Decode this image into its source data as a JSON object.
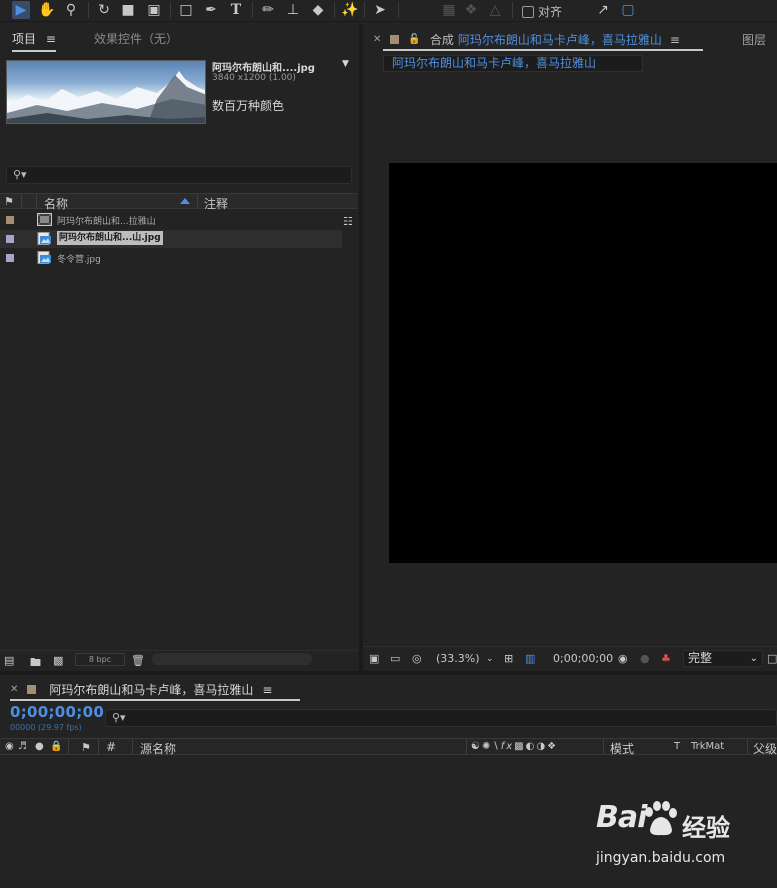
{
  "toolbar": {
    "tools": [
      "selection-tool",
      "hand-tool",
      "zoom-tool",
      "rotate-tool",
      "camera-tool",
      "pan-behind-tool",
      "rectangle-tool",
      "pen-tool",
      "type-tool",
      "brush-tool",
      "clone-stamp-tool",
      "eraser-tool",
      "roto-brush-tool",
      "puppet-pin-tool"
    ],
    "snap_label": "对齐"
  },
  "project_panel": {
    "tab_project": "项目",
    "tab_project_menu": "≡",
    "tab_effects": "效果控件（无）",
    "preview": {
      "name": "阿玛尔布朗山和....jpg",
      "dimensions": "3840 x1200 (1.00)",
      "color_info": "数百万种颜色"
    },
    "columns": {
      "name": "名称",
      "comment": "注释"
    },
    "items": [
      {
        "label": "阿玛尔布朗山和...拉雅山",
        "type": "composition",
        "label_color": "#a38f70",
        "selected": false
      },
      {
        "label": "阿玛尔布朗山和...山.jpg",
        "type": "footage",
        "label_color": "#a8a4c8",
        "selected": true
      },
      {
        "label": "冬令营.jpg",
        "type": "footage",
        "label_color": "#a8a4c8",
        "selected": false
      }
    ],
    "bpc": "8 bpc"
  },
  "comp_panel": {
    "tab_prefix": "合成",
    "comp_name": "阿玛尔布朗山和马卡卢峰，喜马拉雅山",
    "tab_menu": "≡",
    "layers_tab": "图层",
    "breadcrumb": "阿玛尔布朗山和马卡卢峰，喜马拉雅山",
    "zoom": "(33.3%)",
    "timecode": "0;00;00;00",
    "quality": "完整"
  },
  "timeline": {
    "comp_name": "阿玛尔布朗山和马卡卢峰，喜马拉雅山",
    "tab_menu": "≡",
    "timecode": "0;00;00;00",
    "frames": "00000 (29.97 fps)",
    "columns": {
      "hash": "#",
      "source_name": "源名称",
      "mode": "模式",
      "t": "T",
      "trkmat": "TrkMat",
      "parent": "父级"
    }
  },
  "watermark": {
    "logo_text_left": "Bai",
    "logo_text_right": "经验",
    "url": "jingyan.baidu.com"
  },
  "colors": {
    "accent_blue": "#4f8fe0",
    "panel_bg": "#232323",
    "comp_label": "#a38f70",
    "footage_label": "#a8a4c8"
  }
}
